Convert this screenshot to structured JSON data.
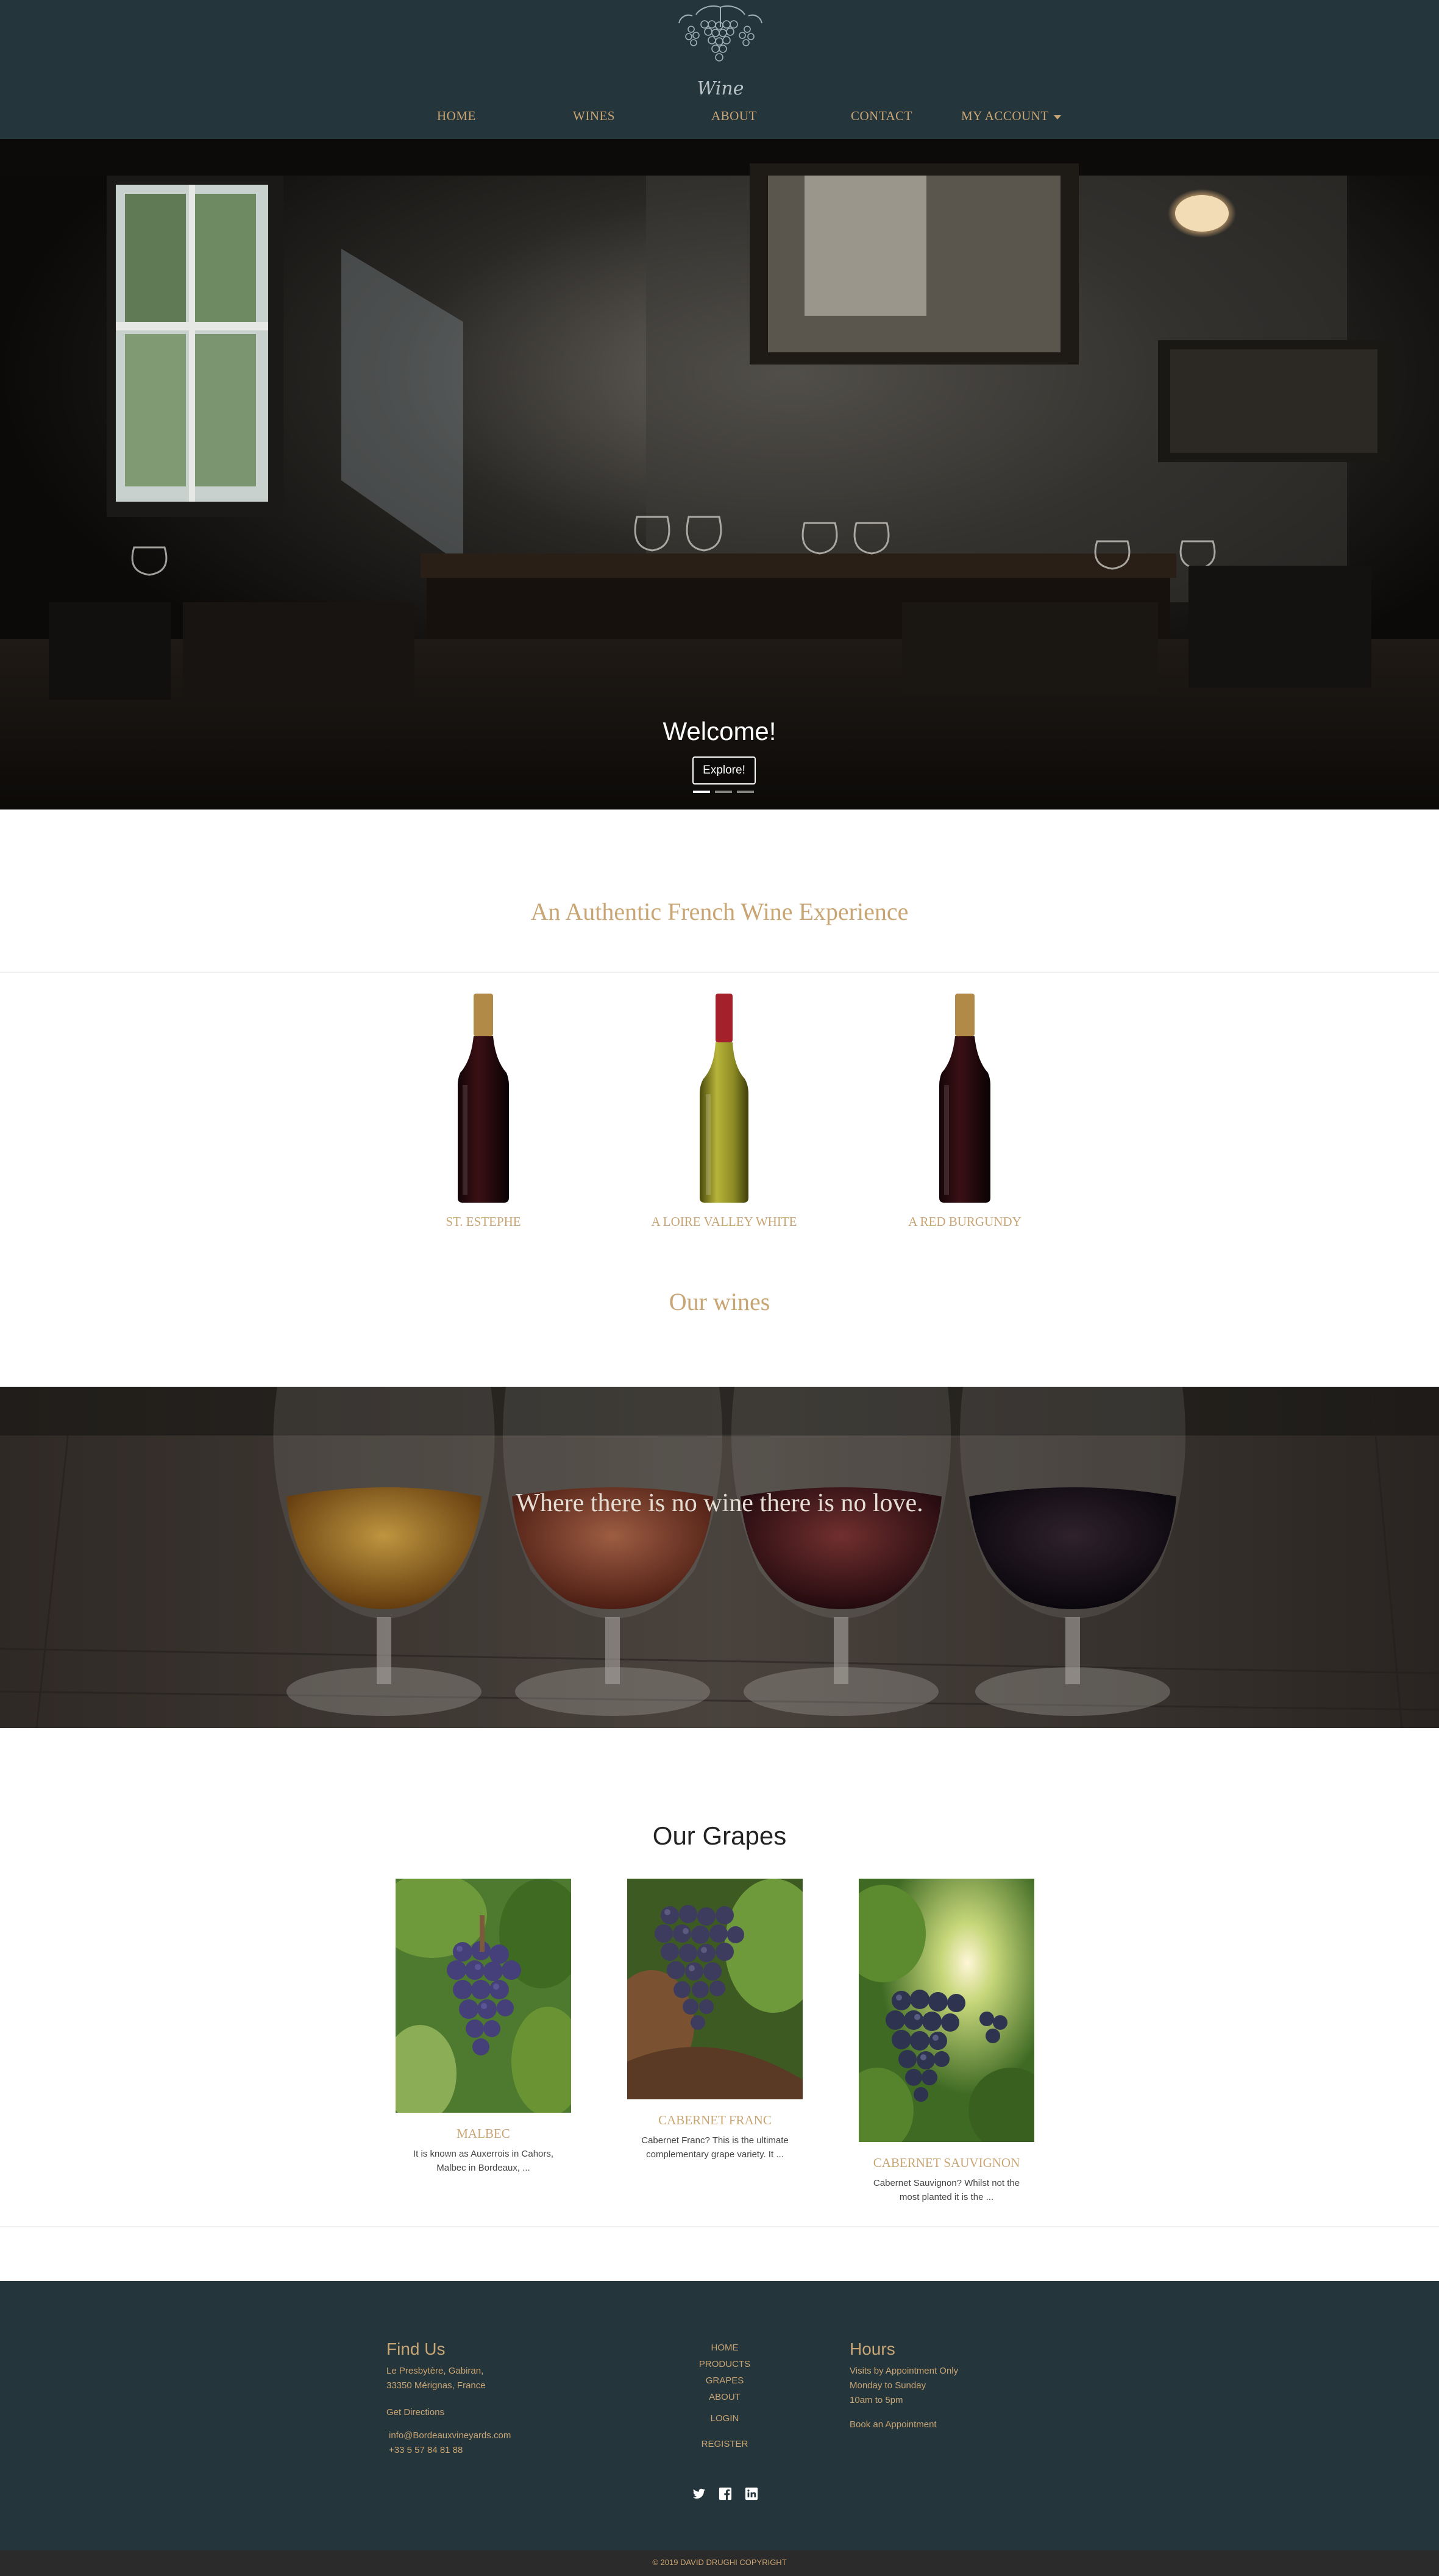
{
  "header": {
    "logo_text": "Wine",
    "nav": [
      "HOME",
      "WINES",
      "ABOUT",
      "CONTACT",
      "MY ACCOUNT"
    ]
  },
  "hero": {
    "heading": "Welcome!",
    "button": "Explore!",
    "slides": 3,
    "active_slide": 1
  },
  "intro": {
    "title": "An Authentic French Wine Experience"
  },
  "wines": [
    {
      "name": "ST. ESTEPHE",
      "color": "red"
    },
    {
      "name": "A LOIRE VALLEY WHITE",
      "color": "white"
    },
    {
      "name": "A RED BURGUNDY",
      "color": "red"
    }
  ],
  "wines_section": {
    "title": "Our wines"
  },
  "quote": {
    "text": "Where there is no wine there is no love."
  },
  "grapes": {
    "title": "Our Grapes",
    "items": [
      {
        "name": "MALBEC",
        "desc_1": "It is known as Auxerrois in Cahors,",
        "desc_2": "Malbec in Bordeaux, ..."
      },
      {
        "name": "CABERNET FRANC",
        "desc_1": "Cabernet Franc? This is the ultimate",
        "desc_2": "complementary grape variety. It ..."
      },
      {
        "name": "CABERNET SAUVIGNON",
        "desc_1": "Cabernet Sauvignon? Whilst not the",
        "desc_2": "most planted it is the ..."
      }
    ]
  },
  "footer": {
    "find_us": {
      "heading": "Find Us",
      "address_1": "Le Presbytère, Gabiran,",
      "address_2": "33350 Mérignas, France",
      "directions": "Get Directions",
      "email": "info@Bordeauxvineyards.com",
      "phone": "+33 5 57 84 81 88"
    },
    "nav": [
      "HOME",
      "PRODUCTS",
      "GRAPES",
      "ABOUT",
      "LOGIN",
      "REGISTER"
    ],
    "hours": {
      "heading": "Hours",
      "line_1": "Visits by Appointment Only",
      "line_2": "Monday to Sunday",
      "line_3": "10am to 5pm",
      "book": "Book an Appointment"
    },
    "social": [
      "twitter-icon",
      "facebook-icon",
      "linkedin-icon"
    ],
    "copyright": "© 2019 DAVID DRUGHI COPYRIGHT"
  },
  "colors": {
    "header_bg": "#24353c",
    "accent_gold": "#c9a574",
    "copyright_bg": "#2b2b2b"
  }
}
